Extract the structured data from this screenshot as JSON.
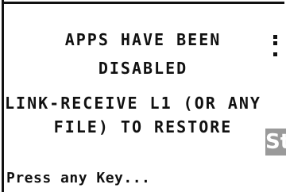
{
  "screen": {
    "line1": "APPS HAVE BEEN",
    "line2": "DISABLED",
    "line3": "LINK-RECEIVE L1 (OR ANY",
    "line4": "FILE) TO RESTORE",
    "prompt": "Press any Key..."
  },
  "overlay": {
    "badge_text": "St"
  },
  "colors": {
    "text": "#111111",
    "background": "#ffffff",
    "badge_background": "#9a9a9a"
  }
}
